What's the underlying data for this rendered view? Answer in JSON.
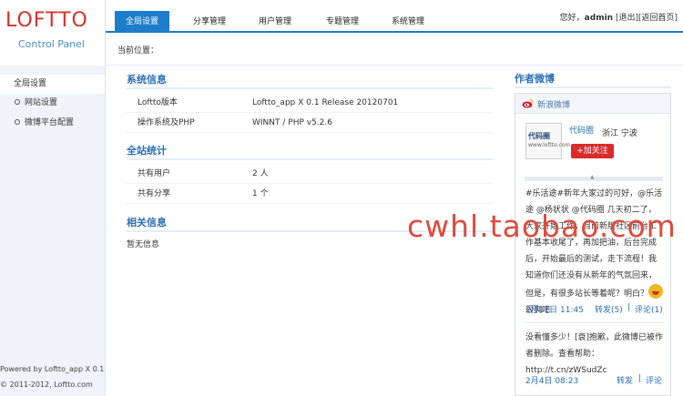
{
  "logo": {
    "title": "LOFTTO",
    "subtitle": "Control Panel"
  },
  "nav": [
    {
      "label": "全局设置",
      "active": true
    },
    {
      "label": "分享管理",
      "active": false
    },
    {
      "label": "用户管理",
      "active": false
    },
    {
      "label": "专题管理",
      "active": false
    },
    {
      "label": "系统管理",
      "active": false
    }
  ],
  "userbar": {
    "greeting": "您好，",
    "username": "admin",
    "logout": "[退出]",
    "back_home": "[返回首页]"
  },
  "breadcrumb": {
    "label": "当前位置："
  },
  "sidebar": {
    "items": [
      {
        "label": "全局设置",
        "active": true
      },
      {
        "label": "网站设置",
        "active": false
      },
      {
        "label": "微博平台配置",
        "active": false
      }
    ],
    "footer": {
      "powered": "Powered by Loftto_app X 0.1",
      "copyright": "© 2011-2012, Loftto.com"
    }
  },
  "system_info": {
    "title": "系统信息",
    "rows": [
      {
        "key": "Loftto版本",
        "value": "Loftto_app X 0.1 Release 20120701"
      },
      {
        "key": "操作系统及PHP",
        "value": "WINNT / PHP v5.2.6"
      }
    ]
  },
  "site_stats": {
    "title": "全站统计",
    "rows": [
      {
        "key": "共有用户",
        "value": "2 人"
      },
      {
        "key": "共有分享",
        "value": "1 个"
      }
    ]
  },
  "related_info": {
    "title": "相关信息",
    "text": "暂无信息"
  },
  "weibo": {
    "title": "作者微博",
    "widget_label": "新浪微博",
    "avatar_text": "代码圈",
    "avatar_sub": "www.loftto.com",
    "name": "代码圈",
    "location": "浙江 宁波",
    "follow_label": "+加关注",
    "scroll_hint": "▲",
    "posts": [
      {
        "text": "#乐活途#新年大家过的可好，@乐活途 @杨状状 @代码圈 几天初二了，大家开始工作，目前新版社区前台工作基本收尾了，再加把油，后台完成后，开始最后的测试，走下流程！我知道你们还没有从新年的气氛回来，但是，有很多站长等着呢？明白？",
        "tail": "很爽吧",
        "date": "2月11日 11:45",
        "repost": "转发(5)",
        "sep": "|",
        "comment": "评论(1)"
      },
      {
        "text": "没看懂多少！[衰]抱歉，此微博已被作者删除。查看帮助：http://t.cn/zWSudZc",
        "date": "2月4日 08:23",
        "repost": "转发",
        "sep": "|",
        "comment": "评论"
      }
    ]
  },
  "watermark": "cwhl.taobao.com",
  "colors": {
    "accent": "#1d7dcb",
    "logo_red": "#d8322a",
    "section_blue": "#2a6fb5",
    "sidebar_bg": "#eef4fa"
  }
}
